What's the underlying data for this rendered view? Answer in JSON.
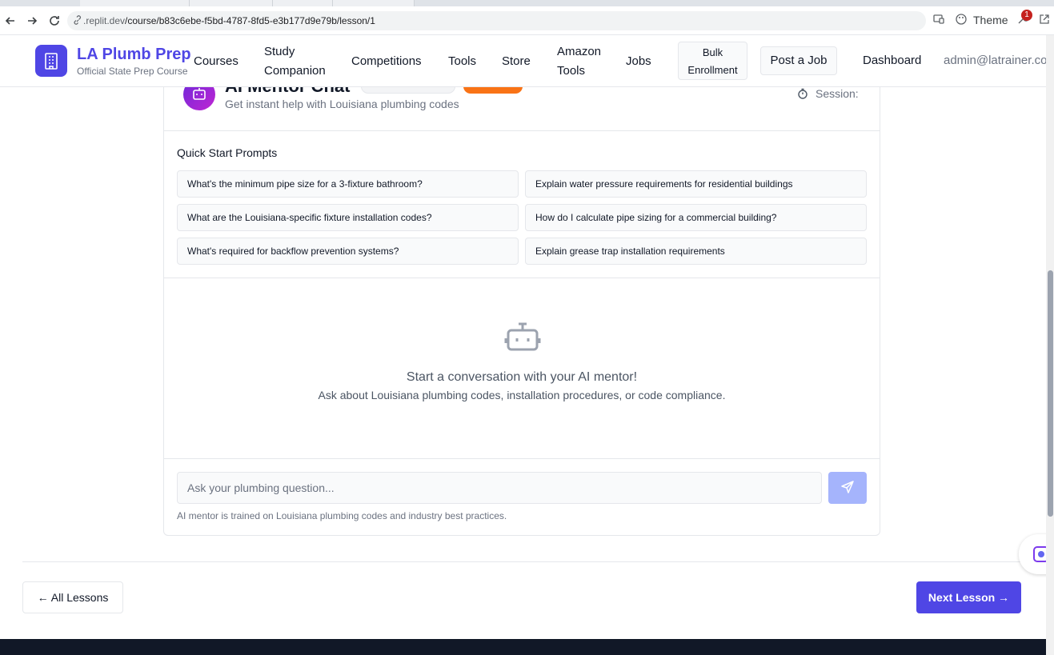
{
  "browser": {
    "url_host": ".replit.dev",
    "url_path": "/course/b83c6ebe-f5bd-4787-8fd5-e3b177d9e79b/lesson/1",
    "theme_label": "Theme",
    "badge_count": "1"
  },
  "header": {
    "brand_title": "LA Plumb Prep",
    "brand_subtitle": "Official State Prep Course",
    "nav": {
      "courses": "Courses",
      "study_line1": "Study",
      "study_line2": "Companion",
      "competitions": "Competitions",
      "tools": "Tools",
      "store": "Store",
      "amazon_line1": "Amazon",
      "amazon_line2": "Tools",
      "jobs": "Jobs",
      "bulk_line1": "Bulk",
      "bulk_line2": "Enrollment",
      "post_job": "Post a Job",
      "dashboard": "Dashboard",
      "user": "admin@latrainer.co"
    }
  },
  "chat": {
    "title": "AI Mentor Chat",
    "subtitle": "Get instant help with Louisiana plumbing codes",
    "session_label": "Session:",
    "prompts_title": "Quick Start Prompts",
    "prompts": [
      "What's the minimum pipe size for a 3-fixture bathroom?",
      "Explain water pressure requirements for residential buildings",
      "What are the Louisiana-specific fixture installation codes?",
      "How do I calculate pipe sizing for a commercial building?",
      "What's required for backflow prevention systems?",
      "Explain grease trap installation requirements"
    ],
    "empty_title": "Start a conversation with your AI mentor!",
    "empty_subtitle": "Ask about Louisiana plumbing codes, installation procedures, or code compliance.",
    "input_placeholder": "Ask your plumbing question...",
    "disclaimer": "AI mentor is trained on Louisiana plumbing codes and industry best practices."
  },
  "footer_nav": {
    "all_lessons": "← All Lessons",
    "next_lesson": "Next Lesson →"
  },
  "colors": {
    "brand": "#4f46e5",
    "send_disabled": "#a5b4fc",
    "badge_orange": "#f97316"
  }
}
